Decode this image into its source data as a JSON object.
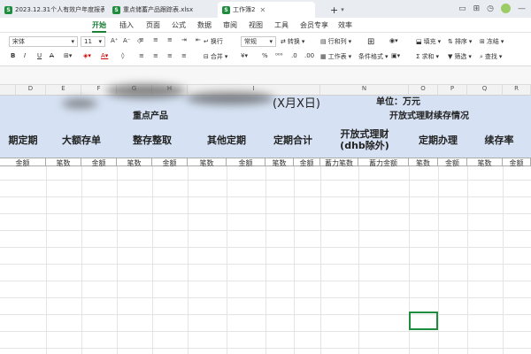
{
  "tabs": [
    {
      "label": "2023.12.31个人有效户年度报表.xlsx"
    },
    {
      "label": "重点储蓄产品跟踪表.xlsx"
    },
    {
      "label": "工作簿2"
    }
  ],
  "tab_add": "+",
  "menus": [
    "开始",
    "插入",
    "页面",
    "公式",
    "数据",
    "审阅",
    "视图",
    "工具",
    "会员专享",
    "效率"
  ],
  "toolbar": {
    "font_name": "宋体",
    "font_size": "11",
    "wrap_label": "换行",
    "format_value": "常规",
    "convert_label": "转换",
    "rowcol_label": "行和列",
    "merge_label": "合并",
    "worksheet_label": "工作表",
    "cond_format_label": "条件格式",
    "fill_label": "填充",
    "sort_label": "排序",
    "freeze_label": "冻结",
    "sum_label": "求和",
    "filter_label": "筛选",
    "find_label": "查找"
  },
  "columns": [
    "D",
    "E",
    "F",
    "G",
    "H",
    "I",
    "N",
    "O",
    "P",
    "Q",
    "R"
  ],
  "table": {
    "unit": "单位：万元",
    "title_suffix": "(X月X日)",
    "group_key_products": "重点产品",
    "group_open_finance": "开放式理财续存情况",
    "headers": [
      "期定期",
      "大额存单",
      "整存整取",
      "其他定期",
      "定期合计",
      "开放式理财(dhb除外)",
      "定期办理",
      "续存率"
    ],
    "subheaders": [
      "金额",
      "笔数",
      "金额",
      "笔数",
      "金额",
      "笔数",
      "金额",
      "笔数",
      "金额",
      "蓄力笔数",
      "蓄力金额",
      "笔数",
      "金额",
      "笔数",
      "金额"
    ]
  },
  "colors": {
    "accent": "#1a7f37",
    "header_fill": "#d6e2f3",
    "excel_green": "#1e8e3e"
  }
}
